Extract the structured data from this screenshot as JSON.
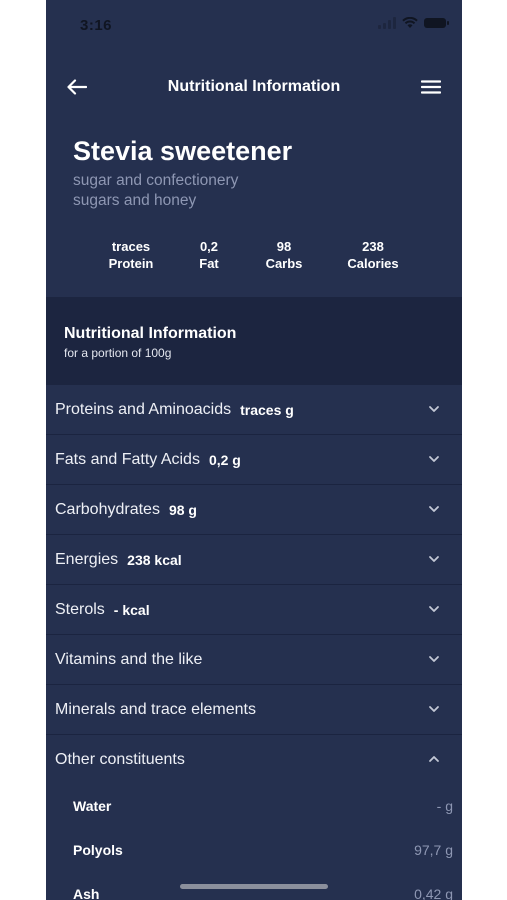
{
  "status": {
    "time": "3:16"
  },
  "nav": {
    "title": "Nutritional Information"
  },
  "food": {
    "name": "Stevia sweetener",
    "category": "sugar and confectionery",
    "subcategory": "sugars and honey"
  },
  "macros": [
    {
      "value": "traces",
      "label": "Protein"
    },
    {
      "value": "0,2",
      "label": "Fat"
    },
    {
      "value": "98",
      "label": "Carbs"
    },
    {
      "value": "238",
      "label": "Calories"
    }
  ],
  "section": {
    "title": "Nutritional Information",
    "subtitle": "for a portion of 100g"
  },
  "rows": [
    {
      "label": "Proteins and Aminoacids",
      "value": "traces g",
      "expanded": false
    },
    {
      "label": "Fats and Fatty Acids",
      "value": "0,2 g",
      "expanded": false
    },
    {
      "label": "Carbohydrates",
      "value": "98 g",
      "expanded": false
    },
    {
      "label": "Energies",
      "value": "238 kcal",
      "expanded": false
    },
    {
      "label": "Sterols",
      "value": "- kcal",
      "expanded": false
    },
    {
      "label": "Vitamins and the like",
      "value": "",
      "expanded": false
    },
    {
      "label": "Minerals and trace elements",
      "value": "",
      "expanded": false
    },
    {
      "label": "Other constituents",
      "value": "",
      "expanded": true
    }
  ],
  "other_constituents": [
    {
      "label": "Water",
      "value": "- g"
    },
    {
      "label": "Polyols",
      "value": "97,7 g"
    },
    {
      "label": "Ash",
      "value": "0,42 g"
    }
  ],
  "icons": {
    "back": "arrow-left-icon",
    "menu": "hamburger-menu-icon",
    "collapsed": "chevron-down-icon",
    "expanded": "chevron-up-icon"
  },
  "colors": {
    "background": "#25304f",
    "section_bg": "#1c2540",
    "muted_text": "#8e97b3",
    "text": "#ffffff"
  }
}
